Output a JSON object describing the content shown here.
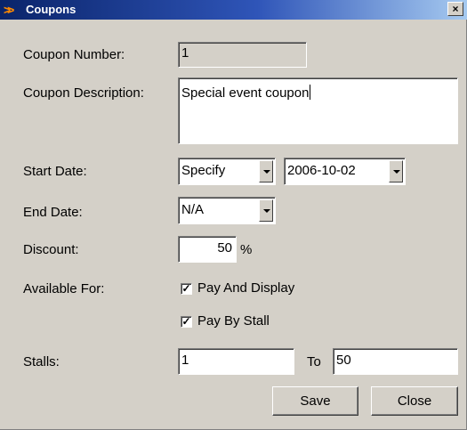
{
  "window": {
    "title": "Coupons",
    "icon": "double-chevron-right-icon",
    "close_glyph": "×"
  },
  "form": {
    "coupon_number_label": "Coupon Number:",
    "coupon_number_value": "1",
    "coupon_description_label": "Coupon Description:",
    "coupon_description_value": "Special event coupon",
    "start_date_label": "Start Date:",
    "start_date_mode": "Specify",
    "start_date_value": "2006-10-02",
    "end_date_label": "End Date:",
    "end_date_mode": "N/A",
    "discount_label": "Discount:",
    "discount_value": "50",
    "discount_unit": "%",
    "available_for_label": "Available For:",
    "pay_and_display_label": "Pay And Display",
    "pay_and_display_checked": true,
    "pay_by_stall_label": "Pay By Stall",
    "pay_by_stall_checked": true,
    "stalls_label": "Stalls:",
    "stalls_from": "1",
    "stalls_to_label": "To",
    "stalls_to": "50"
  },
  "buttons": {
    "save": "Save",
    "close": "Close"
  },
  "colors": {
    "window_bg": "#d4d0c8",
    "title_start": "#0a246a",
    "title_end": "#a6caf0",
    "icon_accent": "#ff8a00"
  }
}
